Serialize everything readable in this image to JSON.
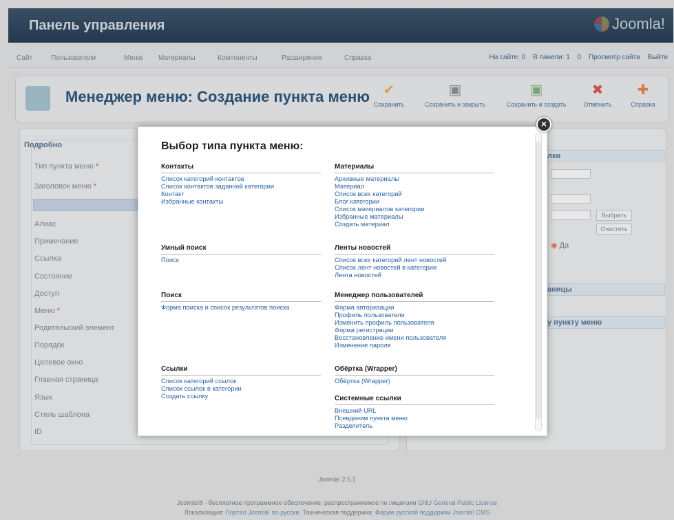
{
  "header": {
    "title": "Панель управления",
    "logo_text": "Joomla!"
  },
  "menubar": {
    "items": [
      "Сайт",
      "Пользователи",
      "Меню",
      "Материалы",
      "Компоненты",
      "Расширения",
      "Справка"
    ],
    "status": {
      "on_site": "На сайте: 0",
      "in_admin": "В панели: 1",
      "messages": "0",
      "view_site": "Просмотр сайта",
      "logout": "Выйти"
    }
  },
  "toolbar": {
    "title": "Менеджер меню: Создание пункта меню",
    "buttons": [
      "Сохранить",
      "Сохранить и закрыть",
      "Сохранить и создать",
      "Отменить",
      "Справка"
    ]
  },
  "form": {
    "legend": "Подробно",
    "fields": [
      "Тип пункта меню",
      "Заголовок меню",
      "Алиас",
      "Примечание",
      "Ссылка",
      "Состояние",
      "Доступ",
      "Меню",
      "Родительский элемент",
      "Порядок",
      "Целевое окно",
      "Главная страница",
      "Язык",
      "Стиль шаблона",
      "ID"
    ]
  },
  "right_panel": {
    "heading_partial": "лки",
    "select_button": "Выбрать",
    "clear_button": "Очистить",
    "radio_yes": "Да",
    "section2": "аницы",
    "section3": "у пункту меню"
  },
  "modal": {
    "title": "Выбор типа пункта меню:",
    "close_symbol": "×",
    "groups": [
      {
        "name": "Контакты",
        "items": [
          "Список категорий контактов",
          "Список контактов заданной категории",
          "Контакт",
          "Избранные контакты"
        ]
      },
      {
        "name": "Материалы",
        "items": [
          "Архивные материалы",
          "Материал",
          "Список всех категорий",
          "Блог категории",
          "Список материалов категории",
          "Избранные материалы",
          "Создать материал"
        ]
      },
      {
        "name": "Умный поиск",
        "items": [
          "Поиск"
        ]
      },
      {
        "name": "Ленты новостей",
        "items": [
          "Список всех категорий лент новостей",
          "Список лент новостей в категории",
          "Лента новостей"
        ]
      },
      {
        "name": "Поиск",
        "items": [
          "Форма поиска и список результатов поиска"
        ]
      },
      {
        "name": "Менеджер пользователей",
        "items": [
          "Форма авторизации",
          "Профиль пользователя",
          "Изменить профиль пользователя",
          "Форма регистрации",
          "Восстановление имени пользователя",
          "Изменение пароля"
        ]
      },
      {
        "name": "Ссылки",
        "items": [
          "Список категорий ссылок",
          "Список ссылок в категории",
          "Создать ссылку"
        ]
      },
      {
        "name": "Обёртка (Wrapper)",
        "items": [
          "Обёртка (Wrapper)"
        ]
      },
      {
        "name": "Системные ссылки",
        "items": [
          "Внешний URL",
          "Псевдоним пункта меню",
          "Разделитель"
        ]
      }
    ]
  },
  "footer": {
    "version": "Joomla! 2.5.1",
    "line1_pre": "Joomla!® - бесплатное программное обеспечение, распространяемое по лицензии",
    "line1_link": "GNU General Public License",
    "line2_pre": "Локализация:",
    "line2_link1": "Портал Joomla! по-русски",
    "line2_mid": ". Техническая поддержка:",
    "line2_link2": "Форум русской поддержки Joomla! CMS"
  },
  "colors": {
    "link": "#2a63a5",
    "header_bg": "#2f4459",
    "title": "#2c4e72"
  }
}
